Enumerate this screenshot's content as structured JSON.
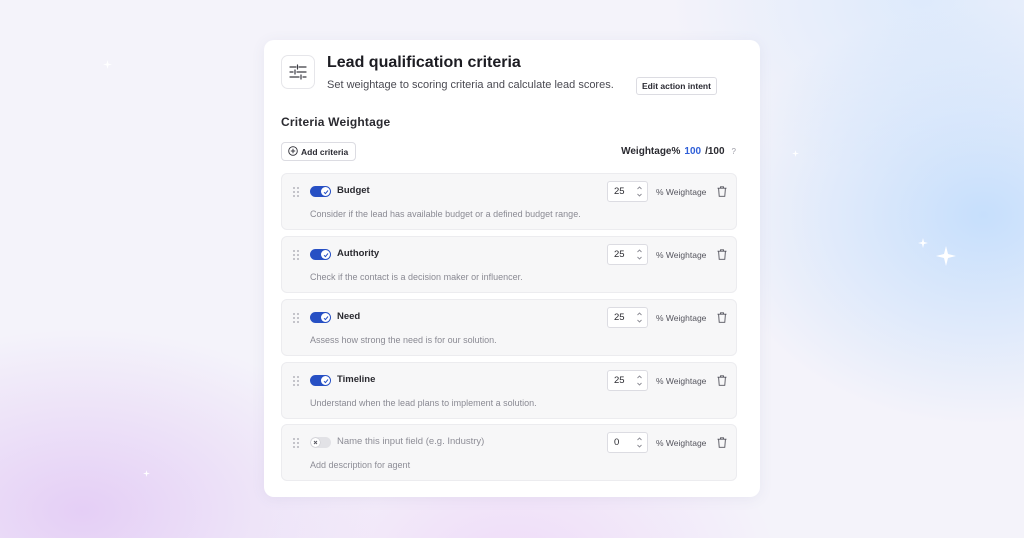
{
  "header": {
    "icon": "sliders-icon",
    "title": "Lead qualification criteria",
    "subtitle": "Set weightage to scoring criteria and calculate lead scores.",
    "edit_intent_label": "Edit action intent"
  },
  "section": {
    "title": "Criteria Weightage",
    "add_label": "Add criteria",
    "weightage_label": "Weightage%",
    "weightage_value": "100",
    "weightage_total": "/100",
    "help": "?"
  },
  "criteria": [
    {
      "name": "Budget",
      "enabled": true,
      "weight": "25",
      "unit": "% Weightage",
      "description": "Consider if the lead has available budget or a defined budget range."
    },
    {
      "name": "Authority",
      "enabled": true,
      "weight": "25",
      "unit": "% Weightage",
      "description": "Check if the contact is a decision maker or influencer."
    },
    {
      "name": "Need",
      "enabled": true,
      "weight": "25",
      "unit": "% Weightage",
      "description": "Assess how strong the need is for our solution."
    },
    {
      "name": "Timeline",
      "enabled": true,
      "weight": "25",
      "unit": "% Weightage",
      "description": "Understand when the lead plans to implement a solution."
    },
    {
      "name": "Name this input field (e.g. Industry)",
      "enabled": false,
      "weight": "0",
      "unit": "% Weightage",
      "description": "Add description for agent"
    }
  ],
  "colors": {
    "accent": "#2f5fd8",
    "toggle_on": "#2750c4",
    "toggle_off": "#e2e2e6"
  }
}
